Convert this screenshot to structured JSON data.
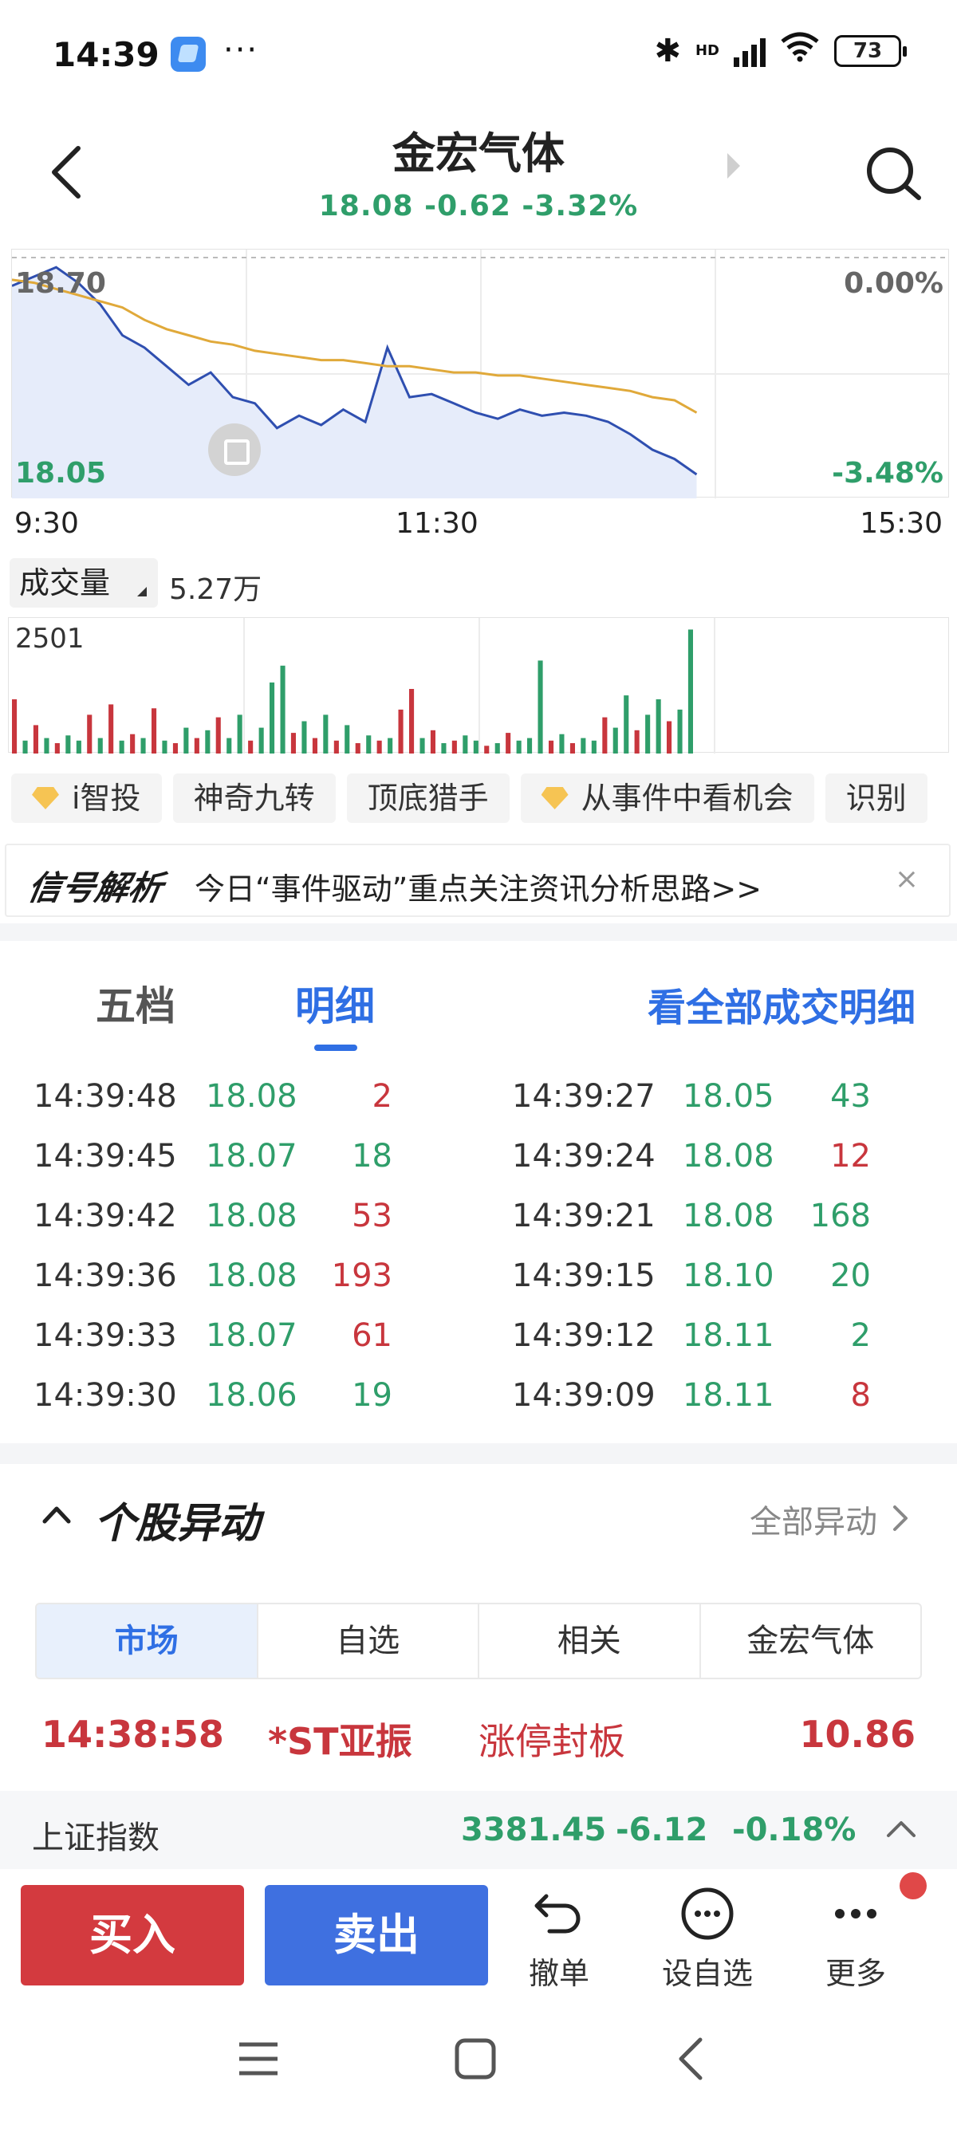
{
  "status_bar": {
    "time": "14:39",
    "dots": "···",
    "hd_label": "HD",
    "battery": "73",
    "icons": [
      "app-icon",
      "bluetooth-icon",
      "signal-icon",
      "wifi-icon",
      "battery-icon"
    ]
  },
  "header": {
    "name": "金宏气体",
    "quote": "18.08 -0.62 -3.32%",
    "icons": [
      "back-arrow-icon",
      "next-stock-icon",
      "search-icon"
    ]
  },
  "chart_data": {
    "type": "line",
    "title": "",
    "x_ticks": [
      "9:30",
      "11:30",
      "15:30"
    ],
    "y_left_labels": [
      "18.70",
      "18.05"
    ],
    "y_right_labels": [
      "0.00%",
      "-3.48%"
    ],
    "ylim": [
      18.05,
      18.7
    ],
    "series": [
      {
        "color": "#2f4fb0",
        "values": [
          18.66,
          18.69,
          18.72,
          18.67,
          18.6,
          18.5,
          18.46,
          18.4,
          18.34,
          18.38,
          18.3,
          18.28,
          18.2,
          18.24,
          18.21,
          18.26,
          18.22,
          18.46,
          18.3,
          18.31,
          18.28,
          18.25,
          18.23,
          18.26,
          18.24,
          18.25,
          18.24,
          18.22,
          18.18,
          18.13,
          18.1,
          18.05
        ]
      },
      {
        "color": "#e0a93a",
        "values": [
          18.68,
          18.67,
          18.65,
          18.63,
          18.61,
          18.59,
          18.55,
          18.52,
          18.5,
          18.48,
          18.47,
          18.45,
          18.44,
          18.43,
          18.42,
          18.42,
          18.41,
          18.4,
          18.4,
          18.39,
          18.38,
          18.38,
          18.37,
          18.37,
          18.36,
          18.35,
          18.34,
          18.33,
          18.32,
          18.3,
          18.29,
          18.25
        ]
      }
    ]
  },
  "volume": {
    "selector_label": "成交量",
    "value": "5.27万",
    "max_label": "2501",
    "bars": [
      {
        "v": 0.42,
        "c": "r"
      },
      {
        "v": 0.1,
        "c": "g"
      },
      {
        "v": 0.22,
        "c": "r"
      },
      {
        "v": 0.12,
        "c": "g"
      },
      {
        "v": 0.08,
        "c": "r"
      },
      {
        "v": 0.14,
        "c": "g"
      },
      {
        "v": 0.1,
        "c": "g"
      },
      {
        "v": 0.3,
        "c": "r"
      },
      {
        "v": 0.12,
        "c": "g"
      },
      {
        "v": 0.38,
        "c": "r"
      },
      {
        "v": 0.1,
        "c": "g"
      },
      {
        "v": 0.15,
        "c": "r"
      },
      {
        "v": 0.12,
        "c": "g"
      },
      {
        "v": 0.35,
        "c": "r"
      },
      {
        "v": 0.1,
        "c": "g"
      },
      {
        "v": 0.08,
        "c": "r"
      },
      {
        "v": 0.2,
        "c": "g"
      },
      {
        "v": 0.12,
        "c": "r"
      },
      {
        "v": 0.18,
        "c": "g"
      },
      {
        "v": 0.28,
        "c": "r"
      },
      {
        "v": 0.12,
        "c": "g"
      },
      {
        "v": 0.3,
        "c": "g"
      },
      {
        "v": 0.1,
        "c": "r"
      },
      {
        "v": 0.2,
        "c": "g"
      },
      {
        "v": 0.55,
        "c": "g"
      },
      {
        "v": 0.68,
        "c": "g"
      },
      {
        "v": 0.16,
        "c": "r"
      },
      {
        "v": 0.25,
        "c": "g"
      },
      {
        "v": 0.12,
        "c": "r"
      },
      {
        "v": 0.3,
        "c": "g"
      },
      {
        "v": 0.1,
        "c": "r"
      },
      {
        "v": 0.22,
        "c": "g"
      },
      {
        "v": 0.08,
        "c": "r"
      },
      {
        "v": 0.14,
        "c": "g"
      },
      {
        "v": 0.1,
        "c": "r"
      },
      {
        "v": 0.12,
        "c": "g"
      },
      {
        "v": 0.34,
        "c": "r"
      },
      {
        "v": 0.5,
        "c": "r"
      },
      {
        "v": 0.12,
        "c": "g"
      },
      {
        "v": 0.18,
        "c": "r"
      },
      {
        "v": 0.08,
        "c": "g"
      },
      {
        "v": 0.1,
        "c": "r"
      },
      {
        "v": 0.14,
        "c": "g"
      },
      {
        "v": 0.1,
        "c": "g"
      },
      {
        "v": 0.06,
        "c": "r"
      },
      {
        "v": 0.08,
        "c": "g"
      },
      {
        "v": 0.16,
        "c": "r"
      },
      {
        "v": 0.1,
        "c": "g"
      },
      {
        "v": 0.12,
        "c": "g"
      },
      {
        "v": 0.72,
        "c": "g"
      },
      {
        "v": 0.1,
        "c": "r"
      },
      {
        "v": 0.15,
        "c": "g"
      },
      {
        "v": 0.08,
        "c": "r"
      },
      {
        "v": 0.12,
        "c": "g"
      },
      {
        "v": 0.1,
        "c": "g"
      },
      {
        "v": 0.28,
        "c": "r"
      },
      {
        "v": 0.2,
        "c": "g"
      },
      {
        "v": 0.45,
        "c": "g"
      },
      {
        "v": 0.18,
        "c": "r"
      },
      {
        "v": 0.3,
        "c": "g"
      },
      {
        "v": 0.42,
        "c": "g"
      },
      {
        "v": 0.25,
        "c": "r"
      },
      {
        "v": 0.34,
        "c": "g"
      },
      {
        "v": 0.96,
        "c": "g"
      }
    ]
  },
  "tools": [
    {
      "label": "i智投",
      "gem": true
    },
    {
      "label": "神奇九转",
      "gem": false
    },
    {
      "label": "顶底猎手",
      "gem": false
    },
    {
      "label": "从事件中看机会",
      "gem": true
    },
    {
      "label": "识别",
      "gem": false
    }
  ],
  "signal_banner": {
    "logo": "信号解析",
    "text": "今日“事件驱动”重点关注资讯分析思路>>",
    "close": "×"
  },
  "tabs": {
    "wudang": "五档",
    "mingxi": "明细",
    "all_link": "看全部成交明细"
  },
  "trades": {
    "left": [
      {
        "time": "14:39:48",
        "price": "18.08",
        "vol": "2",
        "dir": "red"
      },
      {
        "time": "14:39:45",
        "price": "18.07",
        "vol": "18",
        "dir": "green"
      },
      {
        "time": "14:39:42",
        "price": "18.08",
        "vol": "53",
        "dir": "red"
      },
      {
        "time": "14:39:36",
        "price": "18.08",
        "vol": "193",
        "dir": "red"
      },
      {
        "time": "14:39:33",
        "price": "18.07",
        "vol": "61",
        "dir": "red"
      },
      {
        "time": "14:39:30",
        "price": "18.06",
        "vol": "19",
        "dir": "green"
      }
    ],
    "right": [
      {
        "time": "14:39:27",
        "price": "18.05",
        "vol": "43",
        "dir": "green"
      },
      {
        "time": "14:39:24",
        "price": "18.08",
        "vol": "12",
        "dir": "red"
      },
      {
        "time": "14:39:21",
        "price": "18.08",
        "vol": "168",
        "dir": "green"
      },
      {
        "time": "14:39:15",
        "price": "18.10",
        "vol": "20",
        "dir": "green"
      },
      {
        "time": "14:39:12",
        "price": "18.11",
        "vol": "2",
        "dir": "green"
      },
      {
        "time": "14:39:09",
        "price": "18.11",
        "vol": "8",
        "dir": "red"
      }
    ]
  },
  "movers": {
    "title": "个股异动",
    "all_label": "全部异动",
    "segments": [
      "市场",
      "自选",
      "相关",
      "金宏气体"
    ],
    "active_segment": 0,
    "row": {
      "time": "14:38:58",
      "name": "*ST亚振",
      "event": "涨停封板",
      "value": "10.86"
    }
  },
  "index_strip": {
    "name": "上证指数",
    "value": "3381.45",
    "change": "-6.12",
    "pct": "-0.18%"
  },
  "bottom_bar": {
    "buy": "买入",
    "sell": "卖出",
    "cancel": "撤单",
    "watchlist": "设自选",
    "more": "更多"
  },
  "colors": {
    "up": "#c8363d",
    "down": "#2f9e6a",
    "accent": "#2f6fe4",
    "buy": "#d33a3f",
    "sell": "#3f70e0"
  }
}
